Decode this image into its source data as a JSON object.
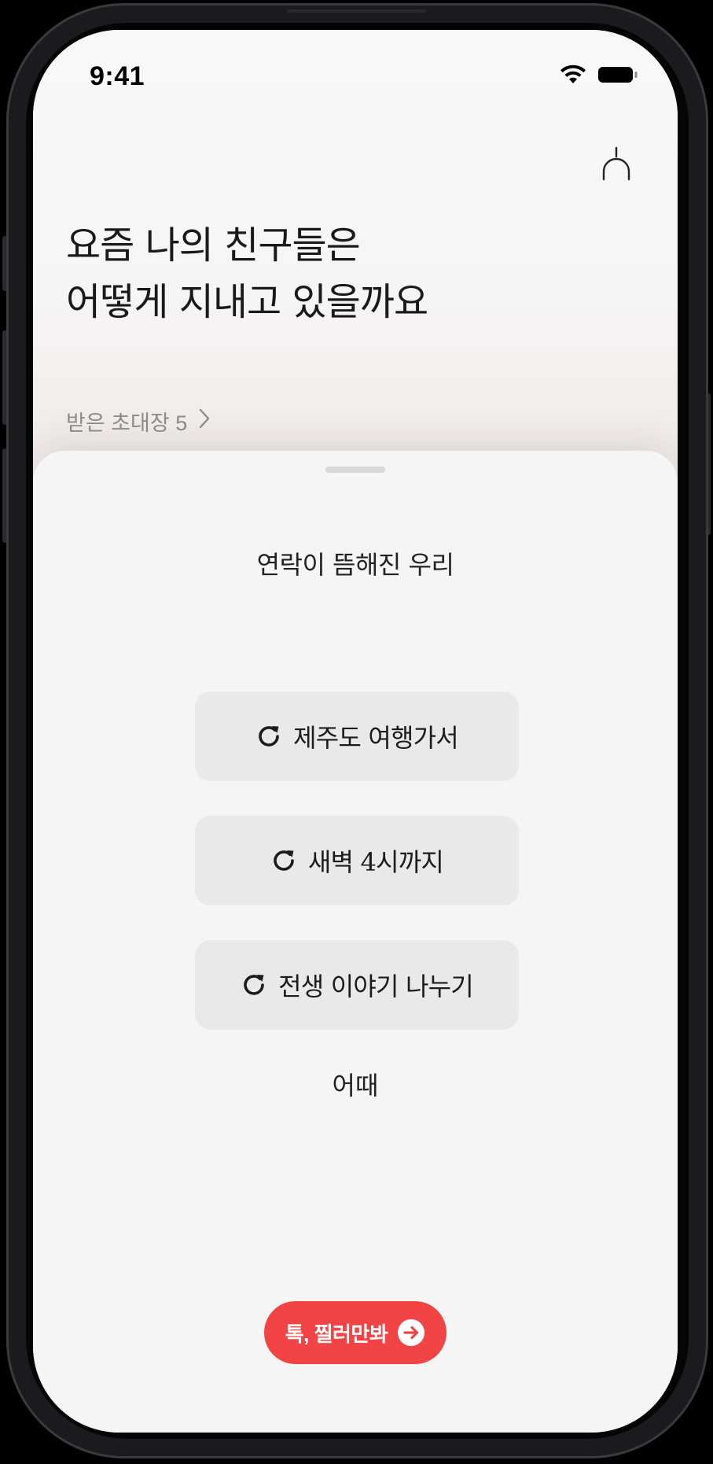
{
  "status_bar": {
    "time": "9:41",
    "icons": [
      "wifi-icon",
      "battery-icon"
    ]
  },
  "header": {
    "notification_icon": "bell-icon",
    "headline_line1": "요즘 나의 친구들은",
    "headline_line2": "어떻게 지내고 있을까요",
    "invites_label": "받은 초대장 5",
    "invites_icon": "chevron-right-icon"
  },
  "sheet": {
    "title": "연락이 뜸해진 우리",
    "topics": [
      {
        "label": "제주도 여행가서",
        "icon": "refresh-icon"
      },
      {
        "label": "새벽 4시까지",
        "icon": "refresh-icon"
      },
      {
        "label": "전생 이야기 나누기",
        "icon": "refresh-icon"
      }
    ],
    "footer": "어때"
  },
  "cta": {
    "label": "톡, 찔러만봐",
    "icon": "arrow-right-circle-icon"
  },
  "colors": {
    "accent": "#f24444",
    "text": "#1a1a1a",
    "muted": "#8d8d8d",
    "sheet_bg": "#f5f5f5",
    "topic_bg": "#e9e9e9"
  }
}
